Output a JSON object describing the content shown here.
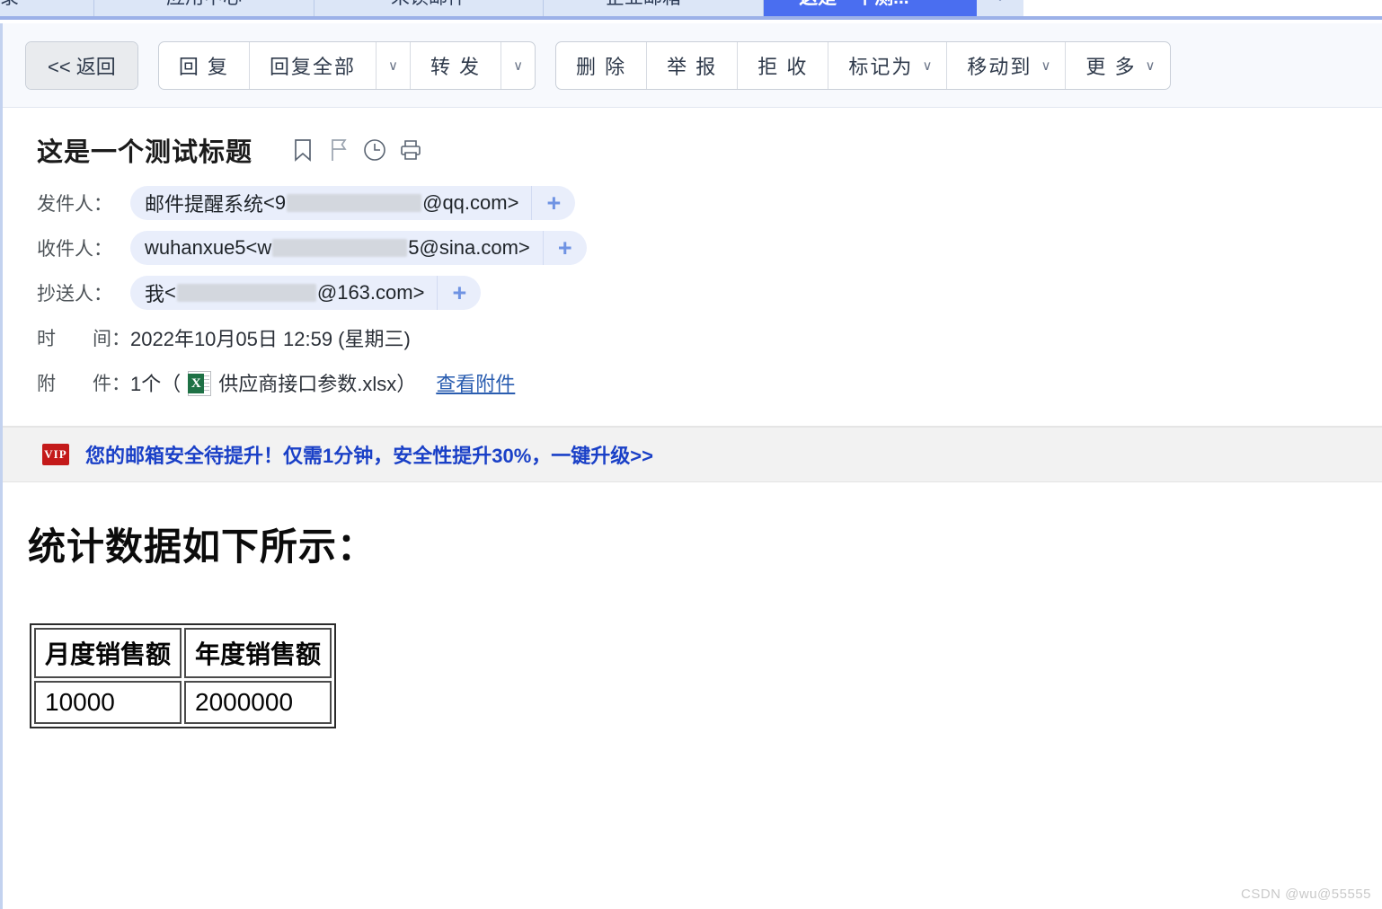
{
  "tabbar": {
    "tabs": [
      {
        "label": "录",
        "closable": false,
        "active": false
      },
      {
        "label": "应用中心",
        "closable": false,
        "active": false
      },
      {
        "label": "未读邮件",
        "closable": false,
        "active": false
      },
      {
        "label": "企业邮箱",
        "closable": true,
        "active": false
      },
      {
        "label": "这是一个测...",
        "closable": true,
        "active": true
      }
    ],
    "close_glyph": "✕",
    "overflow_glyph": "∨"
  },
  "toolbar": {
    "back_label": "<< 返回",
    "reply_label": "回 复",
    "reply_all_label": "回复全部",
    "forward_label": "转 发",
    "delete_label": "删 除",
    "report_label": "举 报",
    "reject_label": "拒 收",
    "mark_as_label": "标记为",
    "move_to_label": "移动到",
    "more_label": "更 多",
    "caret_glyph": "∨"
  },
  "mail": {
    "subject": "这是一个测试标题",
    "icons": [
      "bookmark-icon",
      "flag-icon",
      "clock-icon",
      "print-icon"
    ],
    "from": {
      "label": "发件人：",
      "name": "邮件提醒系统",
      "prefix": "<9",
      "redacted_width": 150,
      "suffix": "@qq.com>",
      "add_glyph": "+"
    },
    "to": {
      "label": "收件人：",
      "name": "wuhanxue5",
      "prefix": "<w",
      "redacted_width": 150,
      "suffix": "5@sina.com>",
      "add_glyph": "+"
    },
    "cc": {
      "label": "抄送人：",
      "name": "我",
      "prefix": "<",
      "redacted_width": 155,
      "suffix": "@163.com>",
      "add_glyph": "+"
    },
    "time": {
      "label_a": "时",
      "label_b": "间：",
      "value": "2022年10月05日 12:59 (星期三)"
    },
    "attachment": {
      "label_a": "附",
      "label_b": "件：",
      "count_text": "1个（",
      "file_name": "供应商接口参数.xlsx",
      "tail_text": "）",
      "view_link": "查看附件",
      "file_icon_letter": "X"
    }
  },
  "vip_banner": {
    "badge": "VIP",
    "text": "您的邮箱安全待提升！仅需1分钟，安全性提升30%，一键升级>>",
    "badge_color": "#c41a1a",
    "text_color": "#1a40c7"
  },
  "body": {
    "heading": "统计数据如下所示：",
    "table": {
      "headers": [
        "月度销售额",
        "年度销售额"
      ],
      "rows": [
        [
          "10000",
          "2000000"
        ]
      ]
    }
  },
  "watermark": "CSDN @wu@55555"
}
